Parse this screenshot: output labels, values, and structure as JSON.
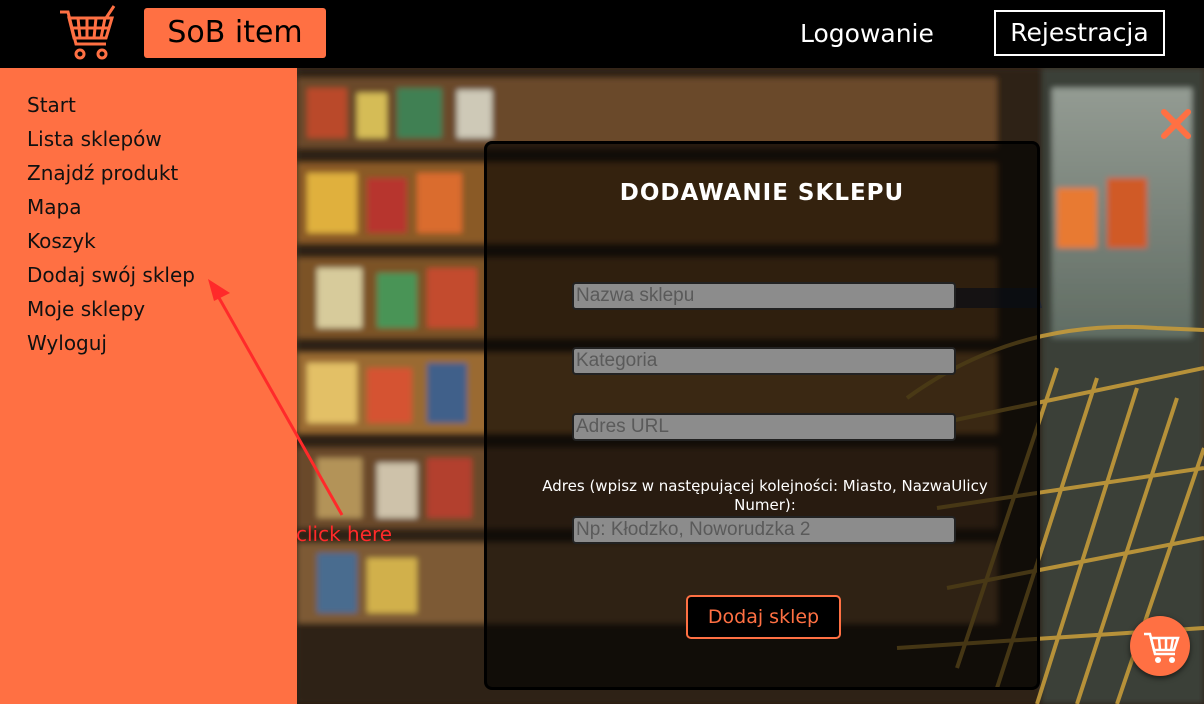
{
  "header": {
    "brand": "SoB item",
    "login_label": "Logowanie",
    "register_label": "Rejestracja",
    "logo_icon": "shopping-cart-icon"
  },
  "sidebar": {
    "items": [
      {
        "label": "Start"
      },
      {
        "label": "Lista sklepów"
      },
      {
        "label": "Znajdź produkt"
      },
      {
        "label": "Mapa"
      },
      {
        "label": "Koszyk"
      },
      {
        "label": "Dodaj swój sklep"
      },
      {
        "label": "Moje sklepy"
      },
      {
        "label": "Wyloguj"
      }
    ]
  },
  "modal": {
    "title": "DODAWANIE SKLEPU",
    "fields": {
      "name_placeholder": "Nazwa sklepu",
      "category_placeholder": "Kategoria",
      "url_placeholder": "Adres URL",
      "address_placeholder": "Np: Kłodzko, Noworudzka 2"
    },
    "address_label": "Adres (wpisz w następującej kolejności: Miasto, NazwaUlicy Numer):",
    "submit_label": "Dodaj sklep"
  },
  "annotation": {
    "text": "click here"
  },
  "colors": {
    "accent": "#ff7043",
    "header_bg": "#000000",
    "annotation": "#ff2a2a"
  }
}
